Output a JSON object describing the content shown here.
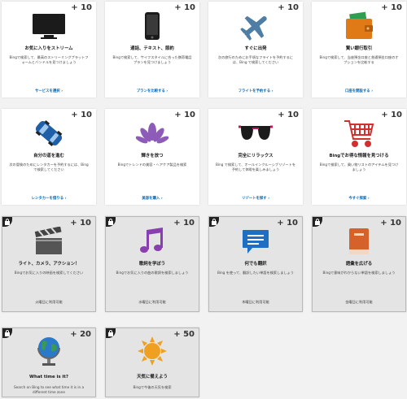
{
  "colors": {
    "link": "#0067b8",
    "locked_bg": "#e4e4e4",
    "card_bg": "#ffffff"
  },
  "cards": [
    {
      "points": "+ 10",
      "title": "お気に入りをストリーム",
      "desc": "Bingで検索して、最高のストリーミングプラットフォームとバンドルを見つけましょう",
      "link": "サービスを選択 ›",
      "icon": "tv-icon"
    },
    {
      "points": "+ 10",
      "title": "通話、テキスト、節約",
      "desc": "Bingで検索して、サイフスタイルに合った携帯電話プランを見つけましょう",
      "link": "プランを比較する ›",
      "icon": "phone-icon"
    },
    {
      "points": "+ 10",
      "title": "すぐに出発",
      "desc": "次の旅行のためにお手頃なフライトを予約するには、Bing で検索してください",
      "link": "フライトを予約する ›",
      "icon": "airplane-icon"
    },
    {
      "points": "+ 10",
      "title": "賢い銀行取引",
      "desc": "Bingで検索して、当座預金口座と普通預金口座のオプションを比較する",
      "link": "口座を開設する ›",
      "icon": "wallet-icon"
    },
    {
      "points": "+ 10",
      "title": "自分の道を進む",
      "desc": "次の冒険のためにレンタカーを予約するには、Bing で検索してください",
      "link": "レンタカーを借りる ›",
      "icon": "car-icon"
    },
    {
      "points": "+ 10",
      "title": "輝きを放つ",
      "desc": "Bingでトレンドの美容・ヘアケア製品を検索",
      "link": "美容を購入 ›",
      "icon": "lotus-icon"
    },
    {
      "points": "+ 10",
      "title": "完全にリラックス",
      "desc": "Bing で検索して、オールインクルーシブリゾートを予約して休暇を楽しみましょう",
      "link": "リゾートを探す ›",
      "icon": "sunglasses-icon"
    },
    {
      "points": "+ 10",
      "title": "Bingでお得な情報を見つける",
      "desc": "Bingで検索して、買い物リストのアイテムを見つけましょう",
      "link": "今すぐ探索 ›",
      "icon": "cart-icon"
    },
    {
      "points": "+ 10",
      "title": "ライト、カメラ、アクション！",
      "desc": "Bingでお気に入りの映画を検索してください",
      "avail": "火曜日に利用可能",
      "icon": "clapperboard-icon"
    },
    {
      "points": "+ 10",
      "title": "歌詞を学ぼう",
      "desc": "Bingでお気に入りの曲の歌詞を検索しましょう",
      "avail": "水曜日に利用可能",
      "icon": "music-note-icon"
    },
    {
      "points": "+ 10",
      "title": "何でも翻訳",
      "desc": "Bing を使って、翻訳したい単語を検索しましょう",
      "avail": "木曜日に利用可能",
      "icon": "chat-bubble-icon"
    },
    {
      "points": "+ 10",
      "title": "語彙を広げる",
      "desc": "Bingで意味がわからない単語を検索しましょう",
      "avail": "金曜日に利用可能",
      "icon": "book-icon"
    },
    {
      "points": "+ 20",
      "title": "What time is it?",
      "desc": "Search on Bing to see what time it is in a different time zone",
      "avail": "",
      "icon": "globe-icon"
    },
    {
      "points": "+ 50",
      "title": "天気に備えよう",
      "desc": "Bingで今後の天気を検索",
      "avail": "",
      "icon": "sun-icon"
    }
  ]
}
